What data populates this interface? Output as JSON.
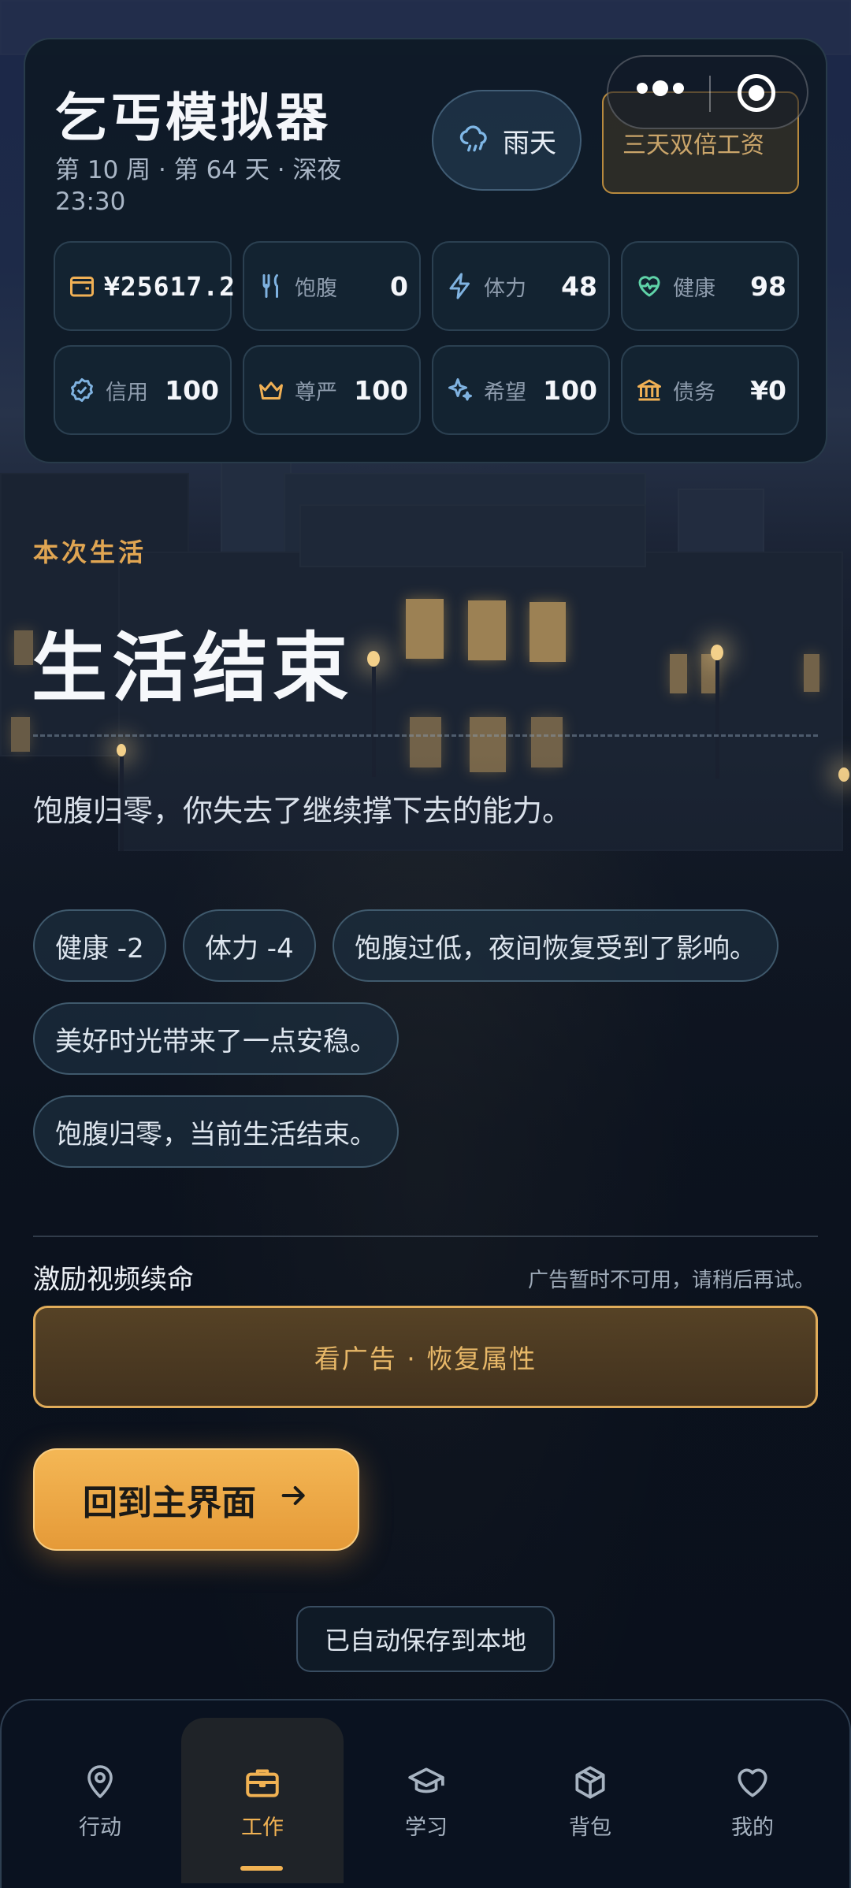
{
  "header": {
    "app_title": "乞丐模拟器",
    "time_text": "第 10 周 · 第 64 天 · 深夜 23:30",
    "weather_label": "雨天",
    "weather_icon": "rain-cloud-icon",
    "bonus_label": "三天双倍工资"
  },
  "stats": [
    {
      "name": "",
      "value": "¥25617.2",
      "icon": "wallet-icon",
      "color": "#f0b055"
    },
    {
      "name": "饱腹",
      "value": "0",
      "icon": "utensils-icon",
      "color": "#7fb2e0"
    },
    {
      "name": "体力",
      "value": "48",
      "icon": "bolt-icon",
      "color": "#7fb2e0"
    },
    {
      "name": "健康",
      "value": "98",
      "icon": "heart-pulse-icon",
      "color": "#5fd3a8"
    },
    {
      "name": "信用",
      "value": "100",
      "icon": "shield-check-icon",
      "color": "#7fb2e0"
    },
    {
      "name": "尊严",
      "value": "100",
      "icon": "crown-icon",
      "color": "#f0b055"
    },
    {
      "name": "希望",
      "value": "100",
      "icon": "sparkles-icon",
      "color": "#7fb2e0"
    },
    {
      "name": "债务",
      "value": "¥0",
      "icon": "bank-icon",
      "color": "#f0b055"
    }
  ],
  "result": {
    "kicker": "本次生活",
    "title": "生活结束",
    "description": "饱腹归零，你失去了继续撑下去的能力。",
    "chips": [
      "健康 -2",
      "体力 -4",
      "饱腹过低，夜间恢复受到了影响。",
      "美好时光带来了一点安稳。",
      "饱腹归零，当前生活结束。"
    ]
  },
  "revive": {
    "title": "激励视频续命",
    "note": "广告暂时不可用，请稍后再试。",
    "ad_button": "看广告 · 恢复属性"
  },
  "home_button": "回到主界面",
  "saved_text": "已自动保存到本地",
  "nav": [
    {
      "label": "行动",
      "icon": "map-pin-icon",
      "active": false
    },
    {
      "label": "工作",
      "icon": "briefcase-icon",
      "active": true
    },
    {
      "label": "学习",
      "icon": "graduation-cap-icon",
      "active": false
    },
    {
      "label": "背包",
      "icon": "package-icon",
      "active": false
    },
    {
      "label": "我的",
      "icon": "heart-icon",
      "active": false
    }
  ],
  "colors": {
    "accent": "#f1b253",
    "background": "#0b1421",
    "card": "#0e1a26"
  }
}
